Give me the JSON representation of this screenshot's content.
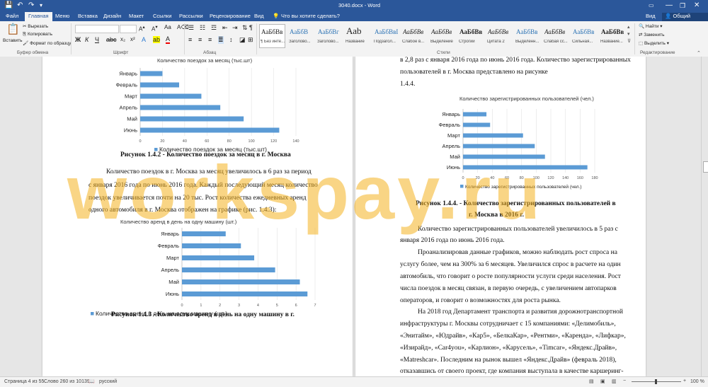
{
  "window": {
    "title": "3040.docx - Word",
    "controls": [
      "—",
      "❐",
      "✕"
    ]
  },
  "tabs": [
    "Файл",
    "Главная",
    "Меню",
    "Вставка",
    "Дизайн",
    "Макет",
    "Ссылки",
    "Рассылки",
    "Рецензирование",
    "Вид"
  ],
  "active_tab": "Главная",
  "tellme": "Что вы хотите сделать?",
  "right_tabs": {
    "view": "Вид",
    "share": "Общий доступ"
  },
  "clipboard": {
    "paste": "Вставить",
    "cut": "Вырезать",
    "copy": "Копировать",
    "format": "Формат по образцу",
    "group": "Буфер обмена"
  },
  "groups": {
    "font": "Шрифт",
    "paragraph": "Абзац",
    "styles": "Стили",
    "editing": "Редактирование"
  },
  "styles": [
    {
      "preview": "АаБбВв",
      "name": "¶ Без инте..."
    },
    {
      "preview": "АаБбВ",
      "name": "Заголово..."
    },
    {
      "preview": "АаБбВг",
      "name": "Заголово..."
    },
    {
      "preview": "Ааb",
      "name": "Название"
    },
    {
      "preview": "АаБбВвГ",
      "name": "Подзагол..."
    },
    {
      "preview": "АаБбВв",
      "name": "Слабое в..."
    },
    {
      "preview": "АаБбВв",
      "name": "Выделение"
    },
    {
      "preview": "АаБбВв",
      "name": "Строгий"
    },
    {
      "preview": "АаБбВв",
      "name": "Цитата 2"
    },
    {
      "preview": "АаБбВв",
      "name": "Выделенн..."
    },
    {
      "preview": "АаБбВв",
      "name": "Слабая сс..."
    },
    {
      "preview": "АаБбВв",
      "name": "Сильная..."
    },
    {
      "preview": "АаБбВв",
      "name": "Название..."
    }
  ],
  "editing": {
    "find": "Найти",
    "replace": "Заменить",
    "select": "Выделить"
  },
  "status": {
    "page": "Страница 4 из 55",
    "words": "Слово 260 из 10139",
    "lang": "русский",
    "zoom": "100 %"
  },
  "left_page": {
    "fig2_caption": "Рисунок 1.4.2 - Количество поездок за месяц в г. Москва",
    "para1": [
      "Количество поездок в г. Москва за месяц увеличилось в 6 раз за период",
      "с января 2016 года по июнь 2016 года. Каждый последующий месяц количество",
      "поездок  увеличивается почти на 20 тыс. Рост количества ежедневных аренд",
      "одного автомобиля в г. Москва отображен на графике (рис. 1.4.3):"
    ],
    "fig3_caption": "Рисунок 1.4.3 - Количество аренд в день на одну машину в г."
  },
  "right_page": {
    "top_text": [
      "в 2,8 раз с января 2016 года по июнь 2016 года. Количество зарегистрированных",
      "пользователей в г. Москва представлено на рисунке",
      "1.4.4."
    ],
    "fig4_caption_1": "Рисунок 1.4.4. - Количество зарегистрированных пользователей в",
    "fig4_caption_2": "г. Москва в 2016 г.",
    "para1": [
      "Количество  зарегистрированных  пользователей  увеличилось  в  5  раз  с",
      "января 2016 года по июнь 2016 года."
    ],
    "para2": [
      "Проанализировав  данные  графиков,  можно  наблюдать  рост  спроса  на",
      "услугу более, чем на 300% за 6 месяцев. Увеличился спрос в расчете на один",
      "автомобиль, что говорит о росте популярности услуги среди населения. Рост",
      "числа поездок в месяц связан, в первую очередь, с увеличением автопарков",
      "операторов, и говорит о возможностях для роста рынка."
    ],
    "para3": [
      "На 2018 год Департамент транспорта и развития дорожнотранспортной",
      "инфраструктуры г. Москвы сотрудничает с 15 компаниями: «Делимобиль»,",
      "«Энитайм», «Юдрайв», «Кар5», «БелкаКар», «Рентми», «Каренда», «Лифкар»,",
      "«Изирайд», «Car4you», «Карлион», «Карусель», «Timcar», «Яндекс.Драйв»,",
      "«Matreshcar». Последним на рынок вышел «Яндекс.Драйв» (февраль 2018),",
      "отказавшись от своего проект, где компания выступала в качестве каршеринг-"
    ]
  },
  "watermark": "workspay.ru",
  "colors": {
    "bar": "#5b9bd5",
    "brand": "#2b579a",
    "watermark": "#f5b323"
  },
  "chart_data": [
    {
      "type": "bar",
      "title": "Количество поездок за месяц (тыс.шт)",
      "categories": [
        "Январь",
        "Февраль",
        "Март",
        "Апрель",
        "Май",
        "Июнь"
      ],
      "values": [
        20,
        35,
        55,
        72,
        93,
        125
      ],
      "xlim": [
        0,
        140
      ],
      "xticks": [
        0,
        20,
        40,
        60,
        80,
        100,
        120,
        140
      ],
      "legend": "Количество поездок за месяц (тыс.шт)",
      "legend_position": "bottom"
    },
    {
      "type": "bar",
      "title": "Количество аренд в день на одну машину (шт.)",
      "categories": [
        "Январь",
        "Февраль",
        "Март",
        "Апрель",
        "Май",
        "Июнь"
      ],
      "values": [
        2.3,
        3.1,
        3.8,
        4.9,
        6.2,
        6.6
      ],
      "xlim": [
        0,
        7
      ],
      "xticks": [
        0,
        1,
        2,
        3,
        4,
        5,
        6,
        7
      ],
      "legend": "Количество аренд в день на одну машину (шт.)",
      "legend_position": "bottom"
    },
    {
      "type": "bar",
      "title": "Количество зарегистрированных пользователей (чел.)",
      "categories": [
        "Январь",
        "Февраль",
        "Март",
        "Апрель",
        "Май",
        "Июнь"
      ],
      "values": [
        32,
        37,
        82,
        98,
        112,
        170
      ],
      "xlim": [
        0,
        180
      ],
      "xticks": [
        0,
        20,
        40,
        60,
        80,
        100,
        120,
        140,
        160,
        180
      ],
      "legend": "Количество зарегистрированных пользователей (чел.)",
      "legend_position": "bottom"
    }
  ]
}
